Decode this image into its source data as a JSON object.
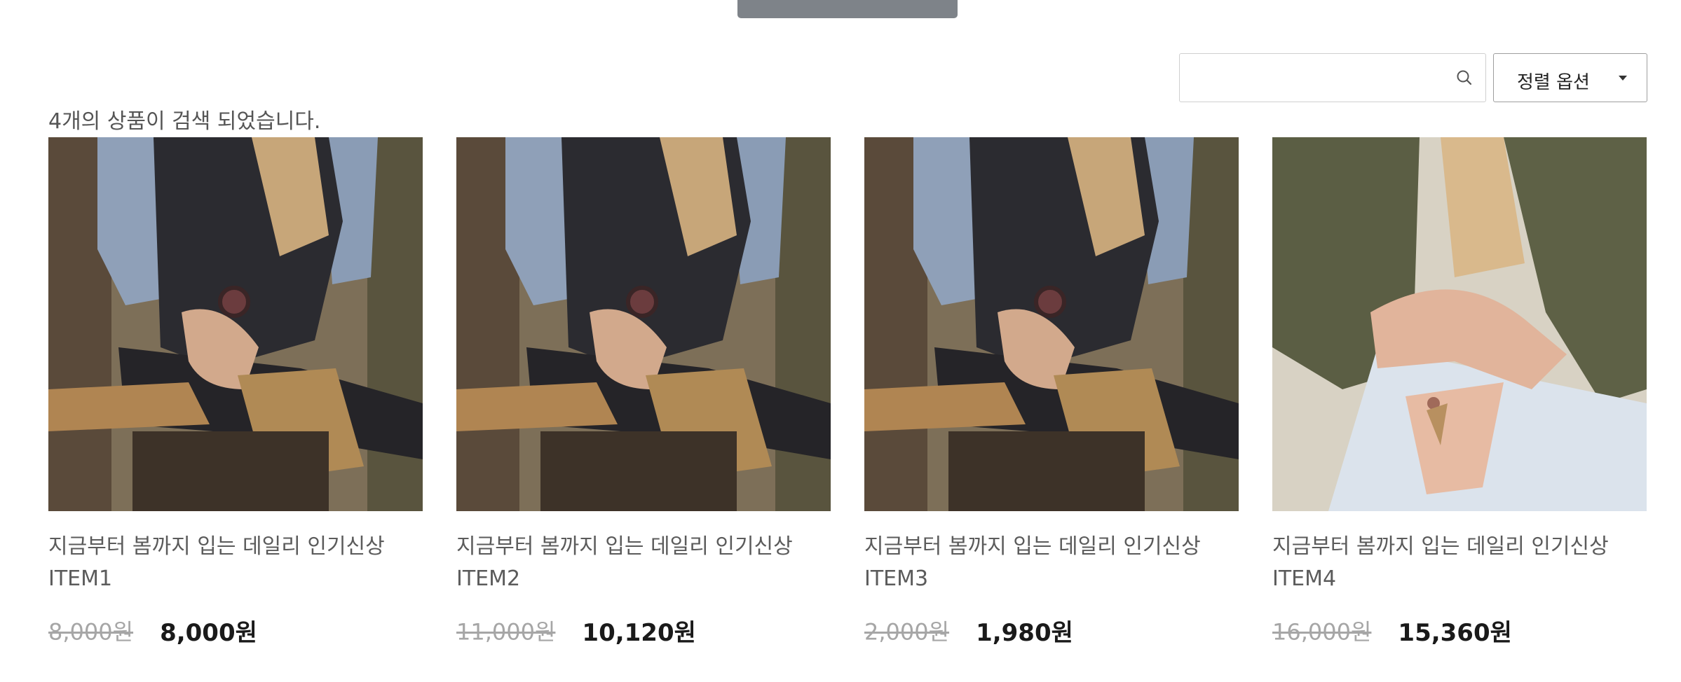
{
  "search": {
    "value": "",
    "placeholder": ""
  },
  "sort": {
    "label": "정렬 옵션"
  },
  "result_count": "4개의 상품이 검색 되었습니다.",
  "products": [
    {
      "name": "지금부터 봄까지 입는 데일리 인기신상 ITEM1",
      "original_price": "8,000원",
      "sale_price": "8,000원",
      "image": "sitting-boots-watch"
    },
    {
      "name": "지금부터 봄까지 입는 데일리 인기신상 ITEM2",
      "original_price": "11,000원",
      "sale_price": "10,120원",
      "image": "sitting-boots-watch"
    },
    {
      "name": "지금부터 봄까지 입는 데일리 인기신상 ITEM3",
      "original_price": "2,000원",
      "sale_price": "1,980원",
      "image": "sitting-boots-watch"
    },
    {
      "name": "지금부터 봄까지 입는 데일리 인기신상 ITEM4",
      "original_price": "16,000원",
      "sale_price": "15,360원",
      "image": "knit-cardigan-rings"
    }
  ],
  "colors": {
    "price_old": "#a6a6a6",
    "price_new": "#1a1a1a",
    "tab": "#7e8389"
  }
}
